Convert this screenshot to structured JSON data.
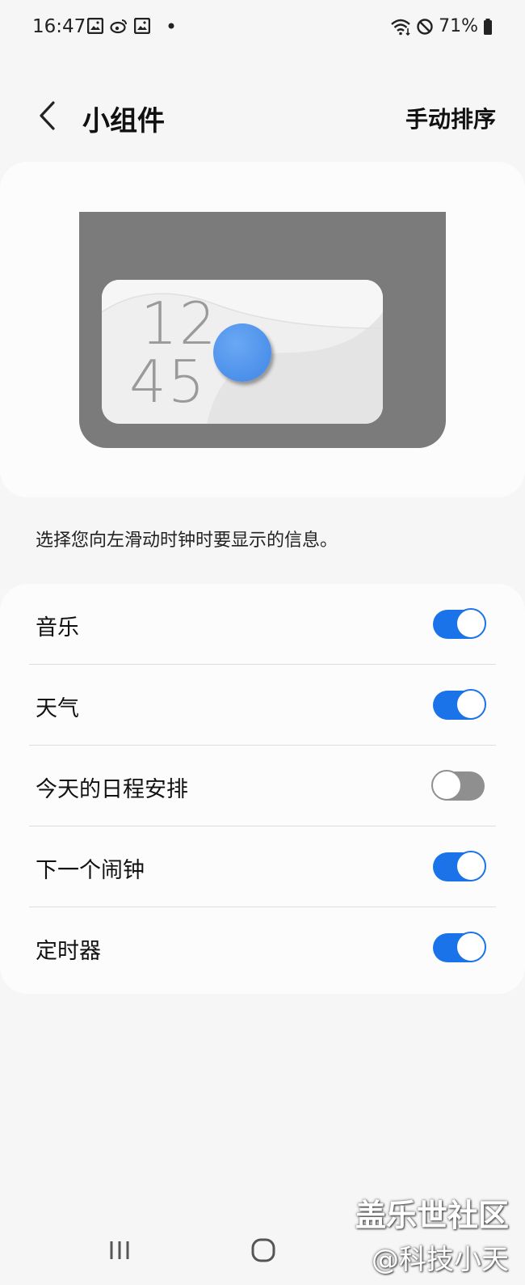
{
  "status_bar": {
    "time": "16:47",
    "battery": "71%",
    "icons_left": [
      "gallery-icon",
      "weibo-icon",
      "gallery-icon",
      "dot-icon"
    ],
    "icons_right": [
      "wifi-icon",
      "do-not-disturb-icon",
      "battery-icon"
    ]
  },
  "header": {
    "title": "小组件",
    "action": "手动排序"
  },
  "preview": {
    "hour": "12",
    "minute": "45"
  },
  "description": "选择您向左滑动时钟时要显示的信息。",
  "settings": [
    {
      "label": "音乐",
      "on": true
    },
    {
      "label": "天气",
      "on": true
    },
    {
      "label": "今天的日程安排",
      "on": false
    },
    {
      "label": "下一个闹钟",
      "on": true
    },
    {
      "label": "定时器",
      "on": true
    }
  ],
  "watermark": {
    "line1": "盖乐世社区",
    "line2": "@科技小天"
  },
  "colors": {
    "accent": "#1a73e8",
    "toggle_off": "#8f8f8f",
    "background": "#f6f6f6",
    "card": "#fcfcfc"
  }
}
